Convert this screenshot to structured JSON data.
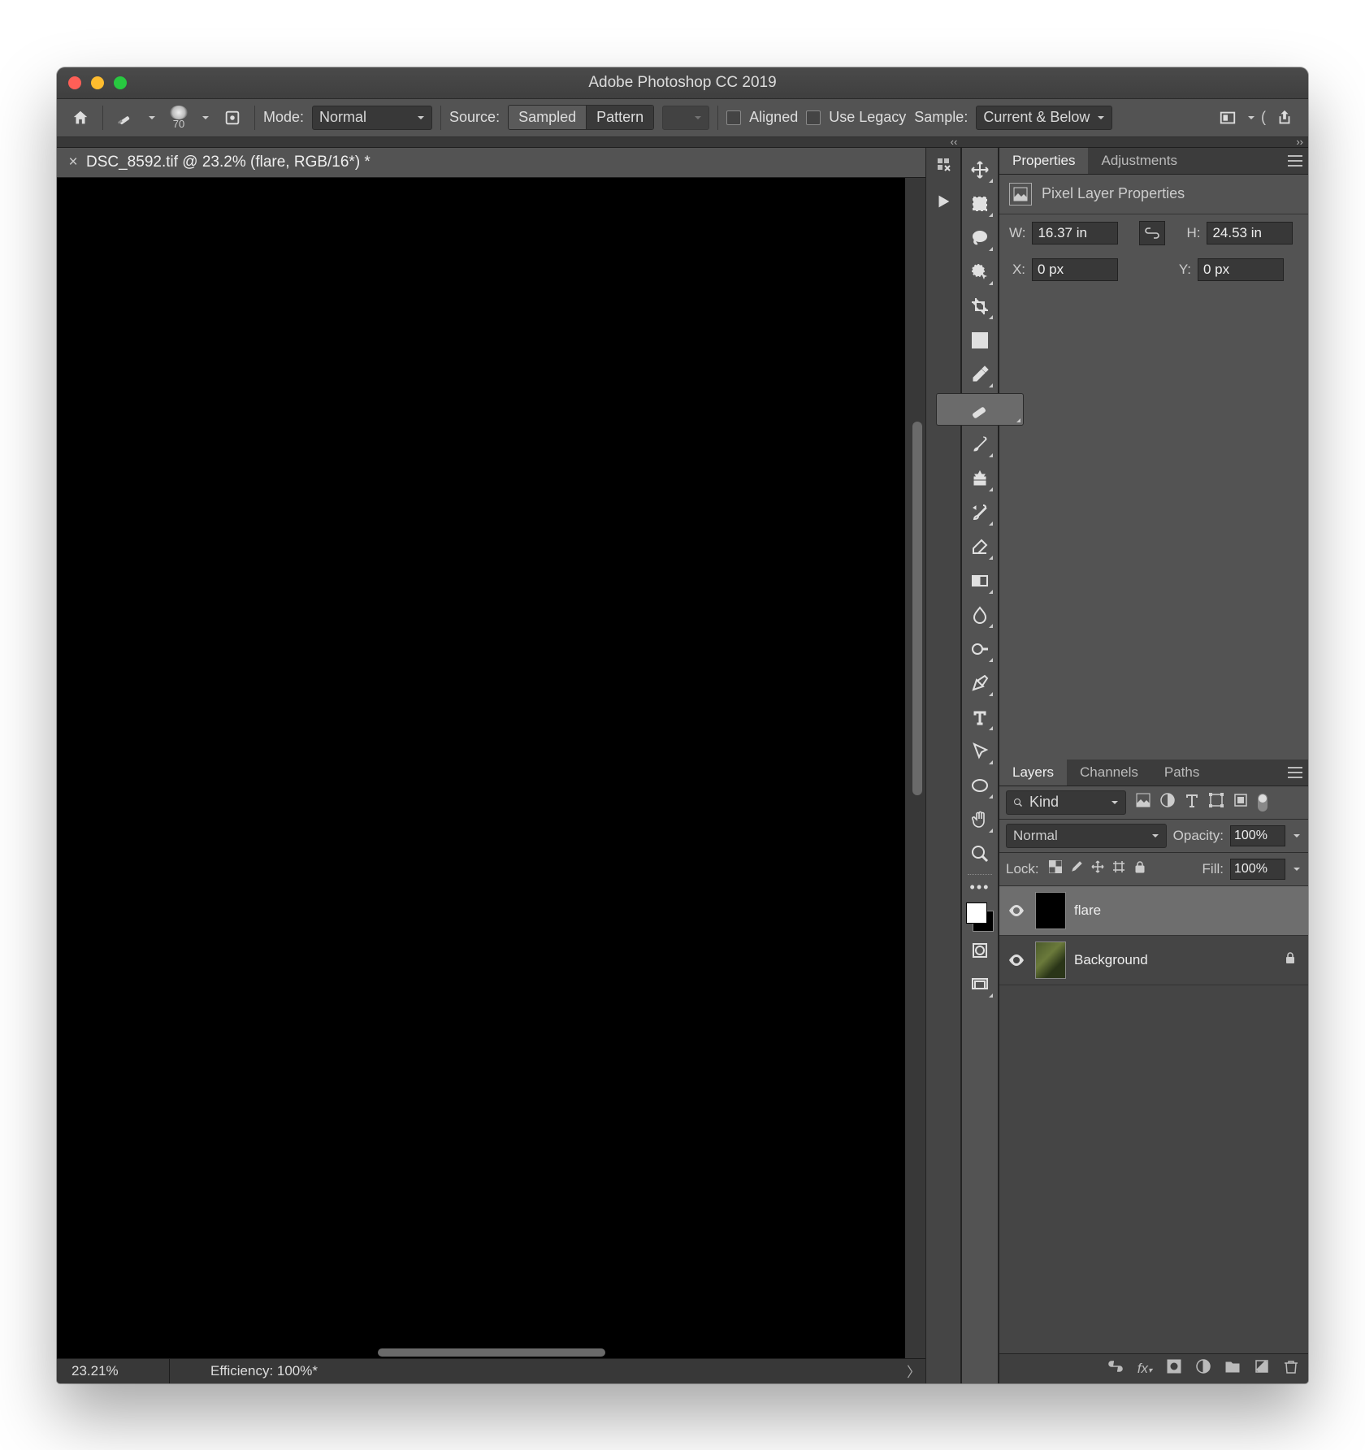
{
  "window": {
    "title": "Adobe Photoshop CC 2019"
  },
  "optionsbar": {
    "brush_size": "70",
    "mode_label": "Mode:",
    "mode_value": "Normal",
    "source_label": "Source:",
    "source_sampled": "Sampled",
    "source_pattern": "Pattern",
    "aligned_label": "Aligned",
    "use_legacy_label": "Use Legacy",
    "sample_label": "Sample:",
    "sample_value": "Current & Below"
  },
  "document": {
    "tab_title": "DSC_8592.tif @ 23.2% (flare, RGB/16*) *",
    "zoom": "23.21%",
    "efficiency": "Efficiency: 100%*"
  },
  "properties": {
    "tab_properties": "Properties",
    "tab_adjustments": "Adjustments",
    "subtitle": "Pixel Layer Properties",
    "w_label": "W:",
    "w_value": "16.37 in",
    "h_label": "H:",
    "h_value": "24.53 in",
    "x_label": "X:",
    "x_value": "0 px",
    "y_label": "Y:",
    "y_value": "0 px"
  },
  "layers_panel": {
    "tab_layers": "Layers",
    "tab_channels": "Channels",
    "tab_paths": "Paths",
    "kind_placeholder": "Kind",
    "blend_mode": "Normal",
    "opacity_label": "Opacity:",
    "opacity_value": "100%",
    "lock_label": "Lock:",
    "fill_label": "Fill:",
    "fill_value": "100%",
    "layers": [
      {
        "name": "flare",
        "selected": true,
        "locked": false,
        "thumb": "black"
      },
      {
        "name": "Background",
        "selected": false,
        "locked": true,
        "thumb": "bgimg"
      }
    ]
  }
}
